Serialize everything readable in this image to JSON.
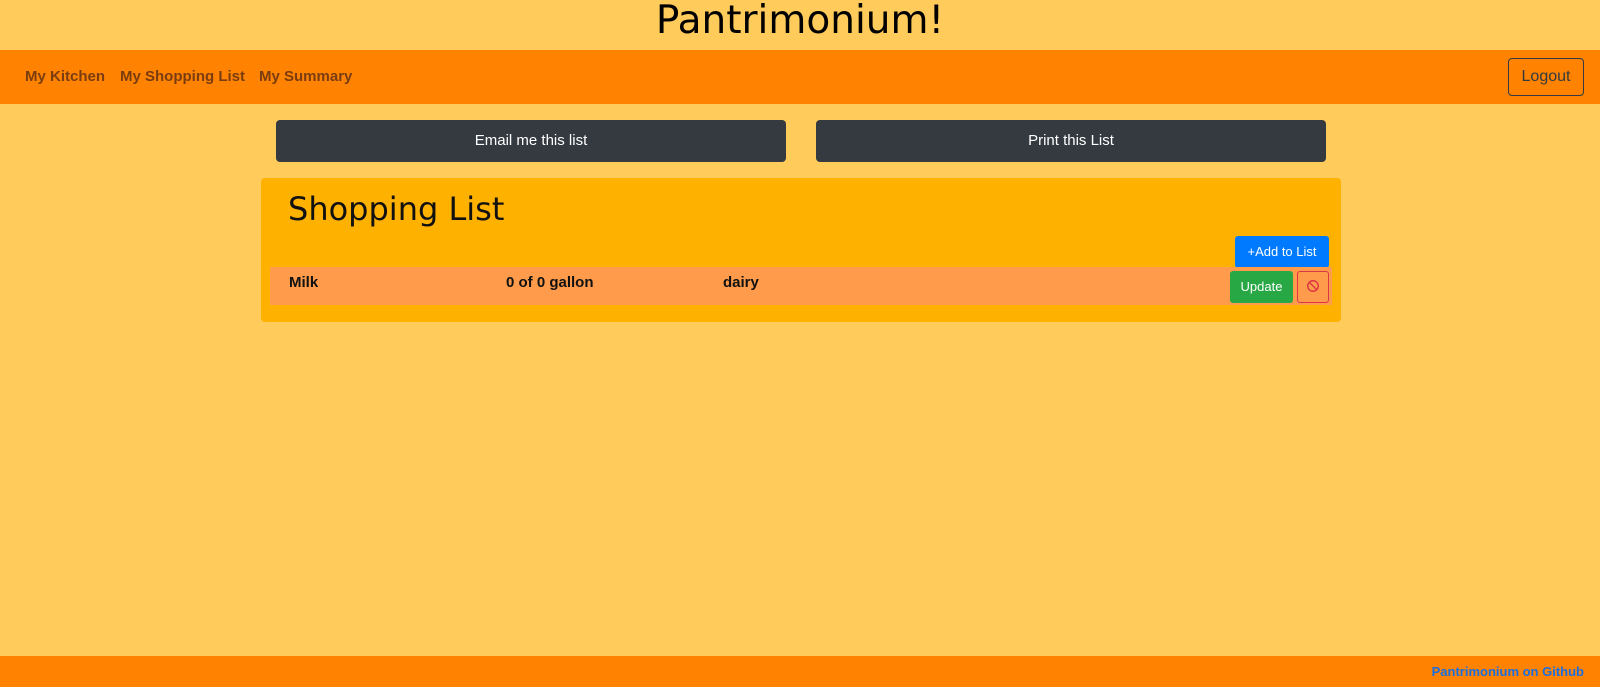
{
  "site": {
    "title": "Pantrimonium!"
  },
  "nav": {
    "items": [
      {
        "label": "My Kitchen"
      },
      {
        "label": "My Shopping List"
      },
      {
        "label": "My Summary"
      }
    ],
    "logout_label": "Logout"
  },
  "actions": {
    "email_label": "Email me this list",
    "print_label": "Print this List"
  },
  "shopping_list": {
    "heading": "Shopping List",
    "add_label": "+Add to List",
    "items": [
      {
        "name": "Milk",
        "quantity": "0 of 0 gallon",
        "category": "dairy",
        "update_label": "Update",
        "remove_icon": "ban-icon"
      }
    ]
  },
  "footer": {
    "link_label": "Pantrimonium on Github"
  },
  "colors": {
    "background": "#ffcb5a",
    "navbar": "#ff8200",
    "card": "#ffb100",
    "row": "#ff9b4b",
    "primary": "#007bff",
    "success": "#28a745",
    "danger": "#dc3545",
    "dark": "#343a40"
  }
}
